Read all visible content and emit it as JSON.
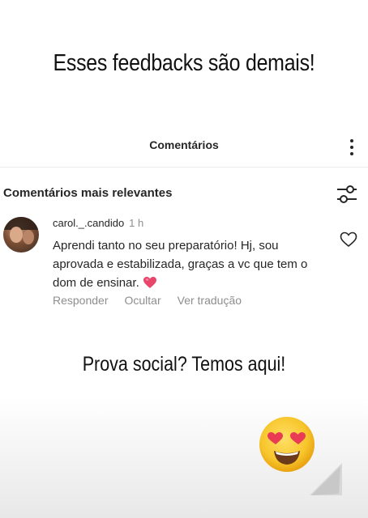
{
  "headline": "Esses feedbacks são demais!",
  "header": {
    "title": "Comentários"
  },
  "section": {
    "title": "Comentários mais relevantes"
  },
  "comment": {
    "username": "carol._.candido",
    "time": "1 h",
    "text": "Aprendi tanto no seu preparatório! Hj, sou aprovada e estabilizada, graças a vc que tem o dom de ensinar."
  },
  "actions": {
    "reply": "Responder",
    "hide": "Ocultar",
    "translate": "Ver tradução"
  },
  "subheadline": "Prova social? Temos aqui!",
  "icons": {
    "more": "more-vertical-icon",
    "filter": "sliders-filter-icon",
    "like": "heart-outline-icon",
    "heart_emoji": "red-heart-emoji",
    "big_emoji": "heart-eyes-emoji"
  },
  "colors": {
    "text": "#262626",
    "muted": "#8e8e8e",
    "heart": "#e8466b",
    "emoji": "#f7c52b"
  }
}
